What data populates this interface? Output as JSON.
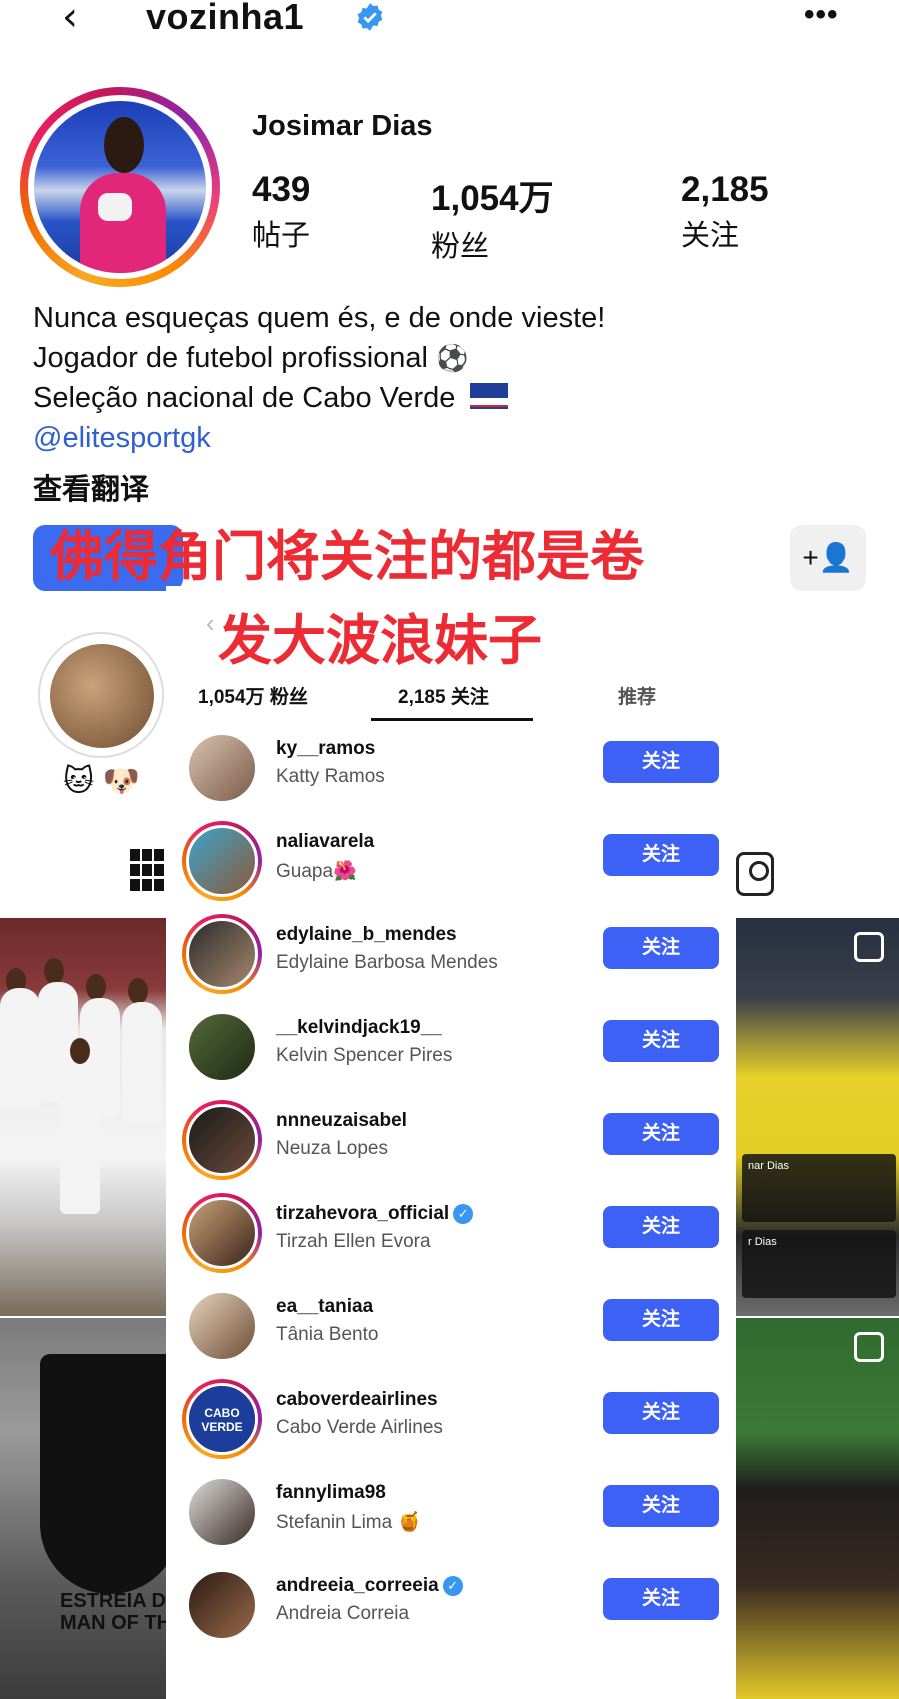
{
  "header": {
    "username": "vozinha1",
    "back_glyph": "‹",
    "more_glyph": "•••"
  },
  "profile": {
    "name": "Josimar Dias",
    "stats": [
      {
        "value": "439",
        "label": "帖子"
      },
      {
        "value": "1,054万",
        "label": "粉丝"
      },
      {
        "value": "2,185",
        "label": "关注"
      }
    ],
    "bio": {
      "line1": "Nunca esqueças quem és, e de onde vieste!",
      "line2": "Jogador de futebol profissional",
      "line3": "Seleção nacional de Cabo Verde",
      "link": "@elitesportgk",
      "translate": "查看翻译"
    },
    "highlight_emojis": "🐱 🐶"
  },
  "annotation": {
    "line1": "佛得角门将关注的都是卷",
    "line2": "发大波浪妹子"
  },
  "following_panel": {
    "tabs": [
      "1,054万 粉丝",
      "2,185 关注",
      "推荐"
    ],
    "button_label": "关注",
    "rows": [
      {
        "handle": "ky__ramos",
        "name": "Katty Ramos",
        "verified": false
      },
      {
        "handle": "naliavarela",
        "name": "Guapa🌺",
        "verified": false
      },
      {
        "handle": "edylaine_b_mendes",
        "name": "Edylaine Barbosa Mendes",
        "verified": false
      },
      {
        "handle": "__kelvindjack19__",
        "name": "Kelvin Spencer Pires",
        "verified": false
      },
      {
        "handle": "nnneuzaisabel",
        "name": "Neuza Lopes",
        "verified": false
      },
      {
        "handle": "tirzahevora_official",
        "name": "Tirzah Ellen Evora",
        "verified": true
      },
      {
        "handle": "ea__taniaa",
        "name": "Tânia Bento",
        "verified": false
      },
      {
        "handle": "caboverdeairlines",
        "name": "Cabo Verde Airlines",
        "verified": false
      },
      {
        "handle": "fannylima98",
        "name": "Stefanin Lima 🍯",
        "verified": false
      },
      {
        "handle": "andreeia_correeia",
        "name": "Andreia Correia",
        "verified": true
      }
    ]
  },
  "grid_photos": {
    "award_caption_1": "ESTREIA DE C",
    "award_caption_2": "MAN OF TH",
    "gk_card_1": "nar Dias",
    "gk_card_2": "r Dias"
  },
  "colors": {
    "primary_button": "#3e61f5",
    "link": "#2f5fd0",
    "annotation_red": "#ec2b35",
    "verified_blue": "#3897f0"
  }
}
